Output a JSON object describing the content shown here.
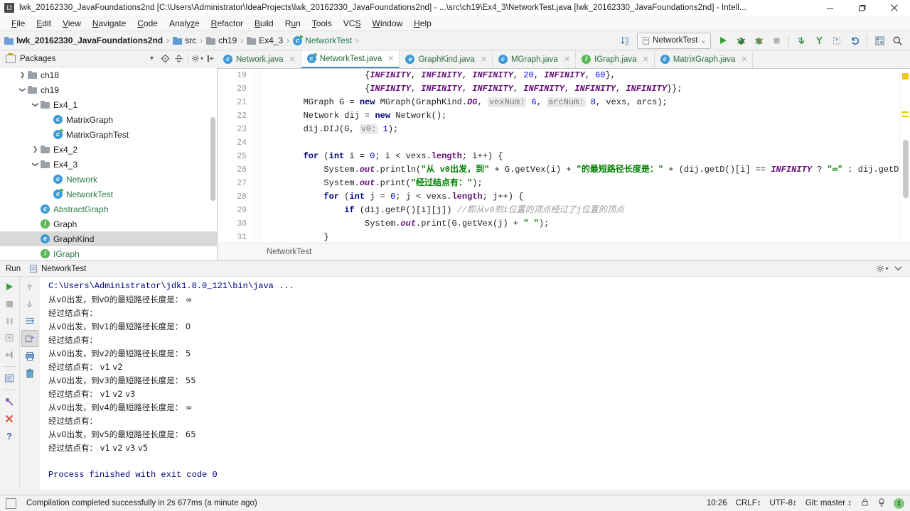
{
  "window": {
    "title": "lwk_20162330_JavaFoundations2nd [C:\\Users\\Administrator\\IdeaProjects\\lwk_20162330_JavaFoundations2nd] - ...\\src\\ch19\\Ex4_3\\NetworkTest.java [lwk_20162330_JavaFoundations2nd] - Intell...",
    "minimize": "—",
    "maximize": "❐",
    "close": "✕",
    "app_icon_letter": "IJ"
  },
  "menu": [
    {
      "label": "File",
      "accel": "F"
    },
    {
      "label": "Edit",
      "accel": "E"
    },
    {
      "label": "View",
      "accel": "V"
    },
    {
      "label": "Navigate",
      "accel": "N"
    },
    {
      "label": "Code",
      "accel": "C"
    },
    {
      "label": "Analyze",
      "accel": "z"
    },
    {
      "label": "Refactor",
      "accel": "R"
    },
    {
      "label": "Build",
      "accel": "B"
    },
    {
      "label": "Run",
      "accel": "u"
    },
    {
      "label": "Tools",
      "accel": "T"
    },
    {
      "label": "VCS",
      "accel": "S"
    },
    {
      "label": "Window",
      "accel": "W"
    },
    {
      "label": "Help",
      "accel": "H"
    }
  ],
  "breadcrumb": [
    {
      "label": "lwk_20162330_JavaFoundations2nd",
      "icon": "project-folder-icon",
      "style": "bold"
    },
    {
      "label": "src",
      "icon": "source-folder-icon",
      "style": "normal"
    },
    {
      "label": "ch19",
      "icon": "folder-icon",
      "style": "normal"
    },
    {
      "label": "Ex4_3",
      "icon": "folder-icon",
      "style": "normal"
    },
    {
      "label": "NetworkTest",
      "icon": "class-run-icon",
      "style": "green"
    }
  ],
  "toolbar": {
    "sort_icon": "sort-numeric-icon",
    "run_config": "NetworkTest",
    "run_config_caret": "⌄",
    "run_icon": "run-icon",
    "debug_icon": "debug-icon",
    "coverage_icon": "run-with-coverage-icon",
    "stop_icon": "stop-icon",
    "update_icon": "vcs-update-icon",
    "commit_icon": "vcs-commit-icon",
    "push_icon": "vcs-push-icon",
    "revert_icon": "revert-icon",
    "structure_icon": "project-structure-icon",
    "search_icon": "search-everywhere-icon"
  },
  "project_panel": {
    "title": "Packages",
    "collapse_caret": "▾",
    "locate_icon": "scroll-from-source-icon",
    "collapse_all_icon": "collapse-all-icon",
    "settings_icon": "gear-icon",
    "hide_icon": "hide-panel-icon"
  },
  "tree": [
    {
      "label": "ch18",
      "indent": 1,
      "arrow": "collapsed",
      "icon": "folder-icon",
      "selected": false,
      "green": false
    },
    {
      "label": "ch19",
      "indent": 1,
      "arrow": "expanded",
      "icon": "folder-icon",
      "selected": false,
      "green": false
    },
    {
      "label": "Ex4_1",
      "indent": 2,
      "arrow": "expanded",
      "icon": "folder-icon",
      "selected": false,
      "green": false
    },
    {
      "label": "MatrixGraph",
      "indent": 3,
      "arrow": "none",
      "icon": "class-icon",
      "selected": false,
      "green": false
    },
    {
      "label": "MatrixGraphTest",
      "indent": 3,
      "arrow": "none",
      "icon": "class-run-icon",
      "selected": false,
      "green": false
    },
    {
      "label": "Ex4_2",
      "indent": 2,
      "arrow": "collapsed",
      "icon": "folder-icon",
      "selected": false,
      "green": false
    },
    {
      "label": "Ex4_3",
      "indent": 2,
      "arrow": "expanded",
      "icon": "folder-icon",
      "selected": false,
      "green": false
    },
    {
      "label": "Network",
      "indent": 3,
      "arrow": "none",
      "icon": "class-icon",
      "selected": false,
      "green": true
    },
    {
      "label": "NetworkTest",
      "indent": 3,
      "arrow": "none",
      "icon": "class-run-icon",
      "selected": false,
      "green": true
    },
    {
      "label": "AbstractGraph",
      "indent": 2,
      "arrow": "none",
      "icon": "abstract-class-icon",
      "selected": false,
      "green": true
    },
    {
      "label": "Graph",
      "indent": 2,
      "arrow": "none",
      "icon": "interface-icon",
      "selected": false,
      "green": false
    },
    {
      "label": "GraphKind",
      "indent": 2,
      "arrow": "none",
      "icon": "enum-icon",
      "selected": true,
      "green": false
    },
    {
      "label": "IGraph",
      "indent": 2,
      "arrow": "none",
      "icon": "interface-icon",
      "selected": false,
      "green": true
    }
  ],
  "editor_tabs": [
    {
      "label": "Network.java",
      "icon": "class-icon",
      "active": false
    },
    {
      "label": "NetworkTest.java",
      "icon": "class-run-icon",
      "active": true
    },
    {
      "label": "GraphKind.java",
      "icon": "enum-icon",
      "active": false
    },
    {
      "label": "MGraph.java",
      "icon": "class-icon",
      "active": false
    },
    {
      "label": "IGraph.java",
      "icon": "interface-icon",
      "active": false
    },
    {
      "label": "MatrixGraph.java",
      "icon": "class-icon",
      "active": false
    }
  ],
  "editor": {
    "line_numbers": [
      "19",
      "20",
      "21",
      "22",
      "23",
      "24",
      "25",
      "26",
      "27",
      "28",
      "29",
      "30",
      "31"
    ],
    "breadcrumb": "NetworkTest"
  },
  "code_lines": [
    [
      {
        "t": "                    {",
        "c": "plain"
      },
      {
        "t": "INFINITY",
        "c": "stat"
      },
      {
        "t": ", ",
        "c": "plain"
      },
      {
        "t": "INFINITY",
        "c": "stat"
      },
      {
        "t": ", ",
        "c": "plain"
      },
      {
        "t": "INFINITY",
        "c": "stat"
      },
      {
        "t": ", ",
        "c": "plain"
      },
      {
        "t": "20",
        "c": "num"
      },
      {
        "t": ", ",
        "c": "plain"
      },
      {
        "t": "INFINITY",
        "c": "stat"
      },
      {
        "t": ", ",
        "c": "plain"
      },
      {
        "t": "60",
        "c": "num"
      },
      {
        "t": "},",
        "c": "plain"
      }
    ],
    [
      {
        "t": "                    {",
        "c": "plain"
      },
      {
        "t": "INFINITY",
        "c": "stat"
      },
      {
        "t": ", ",
        "c": "plain"
      },
      {
        "t": "INFINITY",
        "c": "stat"
      },
      {
        "t": ", ",
        "c": "plain"
      },
      {
        "t": "INFINITY",
        "c": "stat"
      },
      {
        "t": ", ",
        "c": "plain"
      },
      {
        "t": "INFINITY",
        "c": "stat"
      },
      {
        "t": ", ",
        "c": "plain"
      },
      {
        "t": "INFINITY",
        "c": "stat"
      },
      {
        "t": ", ",
        "c": "plain"
      },
      {
        "t": "INFINITY",
        "c": "stat"
      },
      {
        "t": "}};",
        "c": "plain"
      }
    ],
    [
      {
        "t": "        MGraph G = ",
        "c": "plain"
      },
      {
        "t": "new",
        "c": "kw"
      },
      {
        "t": " MGraph(GraphKind.",
        "c": "plain"
      },
      {
        "t": "DG",
        "c": "stat"
      },
      {
        "t": ", ",
        "c": "plain"
      },
      {
        "t": "vexNum:",
        "c": "hint"
      },
      {
        "t": " ",
        "c": "plain"
      },
      {
        "t": "6",
        "c": "num"
      },
      {
        "t": ", ",
        "c": "plain"
      },
      {
        "t": "arcNum:",
        "c": "hint"
      },
      {
        "t": " ",
        "c": "plain"
      },
      {
        "t": "8",
        "c": "num"
      },
      {
        "t": ", vexs, arcs);",
        "c": "plain"
      }
    ],
    [
      {
        "t": "        Network dij = ",
        "c": "plain"
      },
      {
        "t": "new",
        "c": "kw"
      },
      {
        "t": " Network();",
        "c": "plain"
      }
    ],
    [
      {
        "t": "        dij.DIJ(G, ",
        "c": "plain"
      },
      {
        "t": "v0:",
        "c": "hint"
      },
      {
        "t": " ",
        "c": "plain"
      },
      {
        "t": "1",
        "c": "num"
      },
      {
        "t": ");",
        "c": "plain"
      }
    ],
    [],
    [
      {
        "t": "        ",
        "c": "plain"
      },
      {
        "t": "for",
        "c": "kw"
      },
      {
        "t": " (",
        "c": "plain"
      },
      {
        "t": "int",
        "c": "kw"
      },
      {
        "t": " i = ",
        "c": "plain"
      },
      {
        "t": "0",
        "c": "num"
      },
      {
        "t": "; i < vexs.",
        "c": "plain"
      },
      {
        "t": "length",
        "c": "fld"
      },
      {
        "t": "; i++) {",
        "c": "plain"
      }
    ],
    [
      {
        "t": "            System.",
        "c": "plain"
      },
      {
        "t": "out",
        "c": "stat"
      },
      {
        "t": ".println(",
        "c": "plain"
      },
      {
        "t": "\"从 v0出发，到\"",
        "c": "str"
      },
      {
        "t": " + G.getVex(i) + ",
        "c": "plain"
      },
      {
        "t": "\"的最短路径长度是：\"",
        "c": "str"
      },
      {
        "t": " + (dij.getD()[i] == ",
        "c": "plain"
      },
      {
        "t": "INFINITY",
        "c": "stat"
      },
      {
        "t": " ? ",
        "c": "plain"
      },
      {
        "t": "\"∞\"",
        "c": "str"
      },
      {
        "t": " : dij.getD()[i]));",
        "c": "plain"
      }
    ],
    [
      {
        "t": "            System.",
        "c": "plain"
      },
      {
        "t": "out",
        "c": "stat"
      },
      {
        "t": ".print(",
        "c": "plain"
      },
      {
        "t": "\"经过结点有：\"",
        "c": "str"
      },
      {
        "t": ");",
        "c": "plain"
      }
    ],
    [
      {
        "t": "            ",
        "c": "plain"
      },
      {
        "t": "for",
        "c": "kw"
      },
      {
        "t": " (",
        "c": "plain"
      },
      {
        "t": "int",
        "c": "kw"
      },
      {
        "t": " j = ",
        "c": "plain"
      },
      {
        "t": "0",
        "c": "num"
      },
      {
        "t": "; j < vexs.",
        "c": "plain"
      },
      {
        "t": "length",
        "c": "fld"
      },
      {
        "t": "; j++) {",
        "c": "plain"
      }
    ],
    [
      {
        "t": "                ",
        "c": "plain"
      },
      {
        "t": "if",
        "c": "kw"
      },
      {
        "t": " (dij.getP()[i][j]) ",
        "c": "plain"
      },
      {
        "t": "//即从v0到i位置的顶点经过了j位置的顶点",
        "c": "cmt"
      }
    ],
    [
      {
        "t": "                    System.",
        "c": "plain"
      },
      {
        "t": "out",
        "c": "stat"
      },
      {
        "t": ".print(G.getVex(j) + ",
        "c": "plain"
      },
      {
        "t": "\" \"",
        "c": "str"
      },
      {
        "t": ");",
        "c": "plain"
      }
    ],
    [
      {
        "t": "            }",
        "c": "plain"
      }
    ]
  ],
  "run_window": {
    "label": "Run",
    "tab": "NetworkTest",
    "tab_icon": "run-configuration-icon",
    "settings_icon": "gear-icon",
    "hide_icon": "hide-panel-icon",
    "side_buttons": [
      "rerun-icon",
      "stop-icon",
      "pause-icon",
      "dump-threads-icon",
      "restore-layout-icon",
      "print-icon",
      "clear-all-icon",
      "pin-tab-icon",
      "close-icon",
      "help-icon"
    ],
    "side_buttons2": [
      "up-arrow-icon",
      "down-arrow-icon",
      "soft-wrap-icon",
      "scroll-to-end-icon",
      "print-icon",
      "trash-icon"
    ]
  },
  "console_lines": [
    {
      "text": "C:\\Users\\Administrator\\jdk1.8.0_121\\bin\\java ...",
      "kind": "cmd"
    },
    {
      "text": "从v0出发，到v0的最短路径长度是： ∞",
      "kind": "out"
    },
    {
      "text": "经过结点有：",
      "kind": "out"
    },
    {
      "text": "从v0出发，到v1的最短路径长度是： 0",
      "kind": "out"
    },
    {
      "text": "经过结点有：",
      "kind": "out"
    },
    {
      "text": "从v0出发，到v2的最短路径长度是： 5",
      "kind": "out"
    },
    {
      "text": "经过结点有： v1 v2",
      "kind": "out"
    },
    {
      "text": "从v0出发，到v3的最短路径长度是： 55",
      "kind": "out"
    },
    {
      "text": "经过结点有： v1 v2 v3",
      "kind": "out"
    },
    {
      "text": "从v0出发，到v4的最短路径长度是： ∞",
      "kind": "out"
    },
    {
      "text": "经过结点有：",
      "kind": "out"
    },
    {
      "text": "从v0出发，到v5的最短路径长度是： 65",
      "kind": "out"
    },
    {
      "text": "经过结点有： v1 v2 v3 v5",
      "kind": "out"
    },
    {
      "text": "",
      "kind": "out"
    },
    {
      "text": "Process finished with exit code 0",
      "kind": "cmd"
    }
  ],
  "statusbar": {
    "message": "Compilation completed successfully in 2s 677ms (a minute ago)",
    "time": "10:26",
    "line_sep": "CRLF↕",
    "encoding": "UTF-8↕",
    "branch": "Git: master ↕",
    "lock_icon": "lock-icon",
    "inspector_icon": "inspection-icon",
    "notification_count": "1"
  },
  "colors": {
    "accent": "#4a90d9",
    "green_text": "#2b7a4b",
    "keyword": "#000080",
    "string": "#008000",
    "static_field": "#660e7a",
    "marker_yellow": "#f0c419"
  }
}
